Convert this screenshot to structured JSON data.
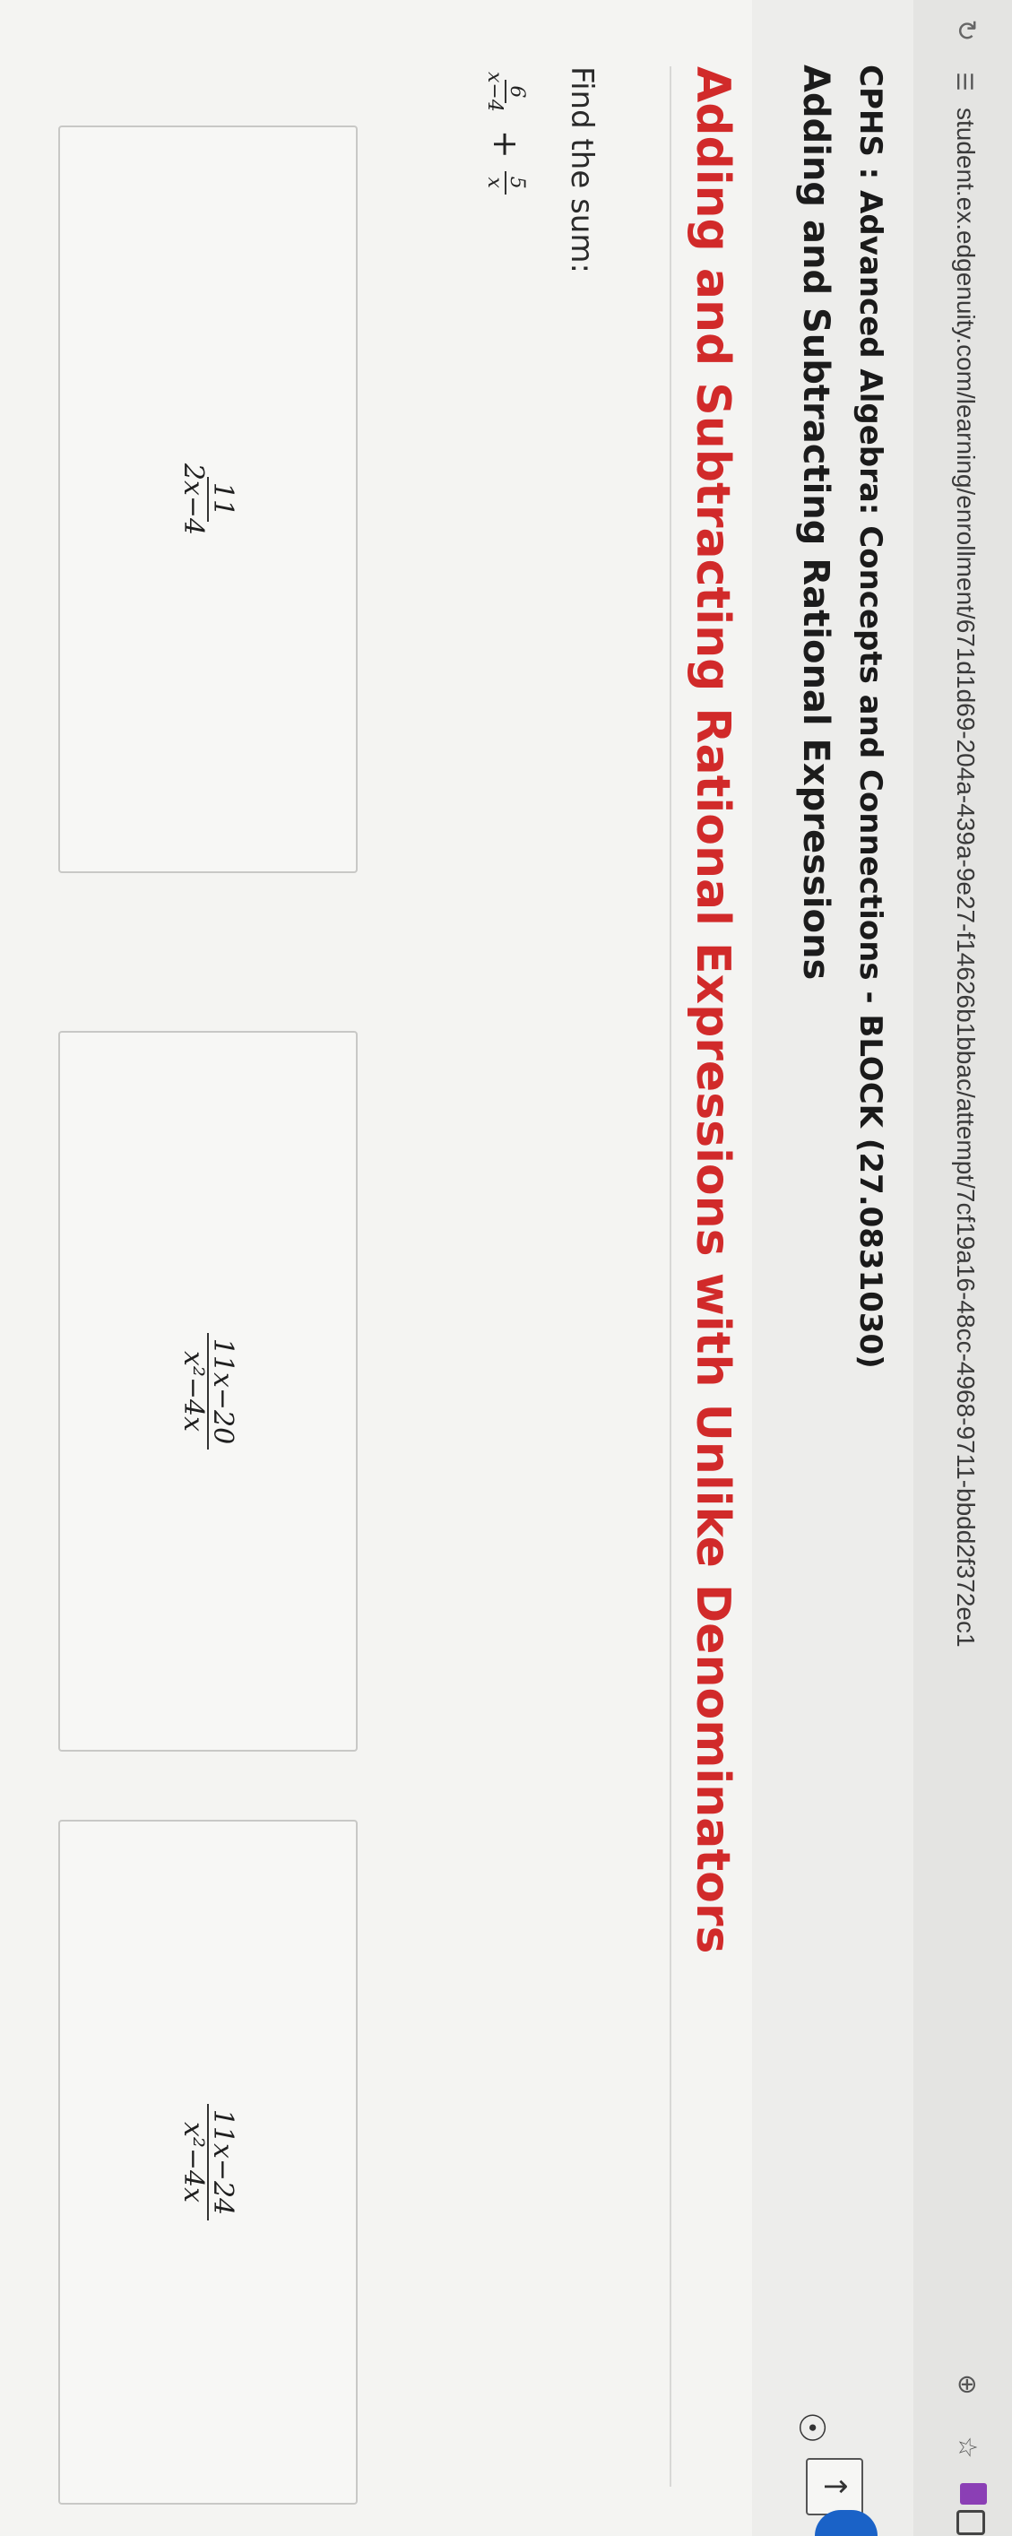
{
  "browser": {
    "url": "student.ex.edgenuity.com/learning/enrollment/671d1d69-204a-439a-9e27-f14626b1bbac/attempt/7cf19a16-48cc-4968-9711-bbdd2f372ec1"
  },
  "course": {
    "title": "CPHS : Advanced Algebra: Concepts and Connections - BLOCK (27.0831030)",
    "lesson": "Adding and Subtracting Rational Expressions"
  },
  "activity": {
    "title": "Adding and Subtracting Rational Expressions with Unlike Denominators",
    "prompt": "Find the sum:",
    "problem": {
      "term1": {
        "num": "6",
        "den": "x−4"
      },
      "operator": "+",
      "term2": {
        "num": "5",
        "den": "x"
      }
    },
    "choices": [
      {
        "num": "11",
        "den": "2x−4"
      },
      {
        "num": "11x−20",
        "den": "x²−4x"
      },
      {
        "num": "11x−24",
        "den": "x²−4x"
      }
    ]
  },
  "icons": {
    "reload": "reload-icon",
    "site_info": "site-info-icon",
    "zoom": "zoom-icon",
    "star": "bookmark-star-icon",
    "help": "help-lightbulb-icon",
    "nav": "upload-nav-icon"
  },
  "colors": {
    "activity_title": "#d12a2a",
    "accent": "#1a62c7"
  }
}
